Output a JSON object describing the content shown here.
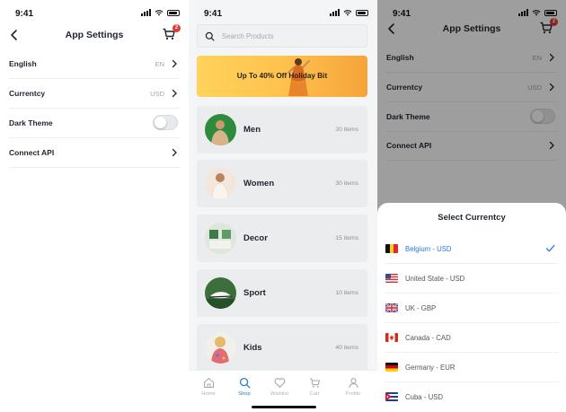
{
  "status": {
    "time": "9:41"
  },
  "settings": {
    "title": "App Settings",
    "cart_badge": "2",
    "rows": [
      {
        "label": "English",
        "value": "EN"
      },
      {
        "label": "Currentcy",
        "value": "USD"
      },
      {
        "label": "Dark Theme",
        "value": ""
      },
      {
        "label": "Connect API",
        "value": ""
      }
    ]
  },
  "shop": {
    "search_placeholder": "Search Products",
    "banner_text": "Up To 40%  Off Holiday Bit",
    "categories": [
      {
        "name": "Men",
        "count": "20 items"
      },
      {
        "name": "Women",
        "count": "30 items"
      },
      {
        "name": "Decor",
        "count": "15 items"
      },
      {
        "name": "Sport",
        "count": "10 items"
      },
      {
        "name": "Kids",
        "count": "40 items"
      }
    ],
    "tabs": [
      {
        "label": "Home",
        "icon": "home-icon"
      },
      {
        "label": "Shop",
        "icon": "search-icon",
        "active": true
      },
      {
        "label": "Wishlist",
        "icon": "heart-icon"
      },
      {
        "label": "Cart",
        "icon": "cart-icon"
      },
      {
        "label": "Profile",
        "icon": "user-icon"
      }
    ]
  },
  "currency_sheet": {
    "title": "Select Currentcy",
    "options": [
      {
        "label": "Belgium - USD",
        "flag": "belgium-flag",
        "selected": true
      },
      {
        "label": "United State - USD",
        "flag": "usa-flag"
      },
      {
        "label": "UK - GBP",
        "flag": "uk-flag"
      },
      {
        "label": "Canada - CAD",
        "flag": "canada-flag"
      },
      {
        "label": "Germany - EUR",
        "flag": "germany-flag"
      },
      {
        "label": "Cuba - USD",
        "flag": "cuba-flag"
      }
    ]
  },
  "colors": {
    "accent": "#2b7bd9",
    "badge": "#e53935",
    "banner": "#ffc24d"
  }
}
